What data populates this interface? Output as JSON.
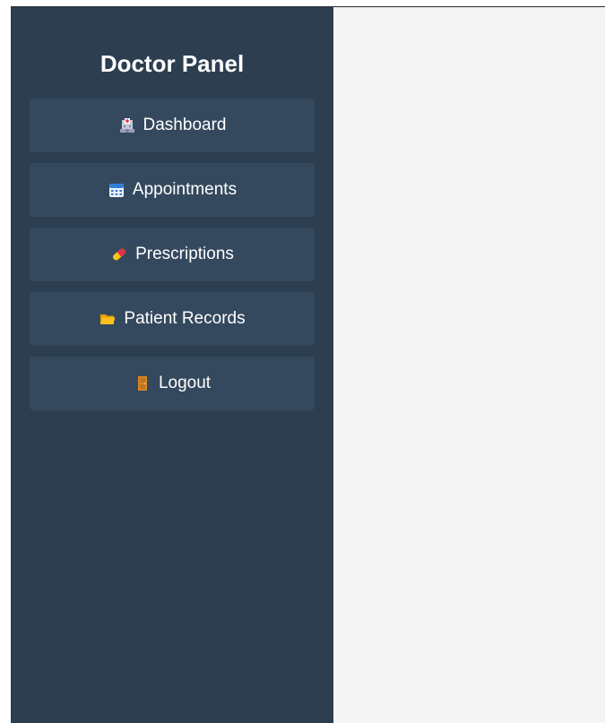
{
  "sidebar": {
    "title": "Doctor Panel",
    "items": [
      {
        "label": "Dashboard",
        "icon": "hospital-icon"
      },
      {
        "label": "Appointments",
        "icon": "calendar-icon"
      },
      {
        "label": "Prescriptions",
        "icon": "pill-icon"
      },
      {
        "label": "Patient Records",
        "icon": "folder-icon"
      },
      {
        "label": "Logout",
        "icon": "door-icon"
      }
    ]
  },
  "colors": {
    "sidebar_bg": "#2c3e50",
    "nav_item_bg": "#34495e",
    "main_bg": "#f4f4f4",
    "text": "#ffffff"
  }
}
